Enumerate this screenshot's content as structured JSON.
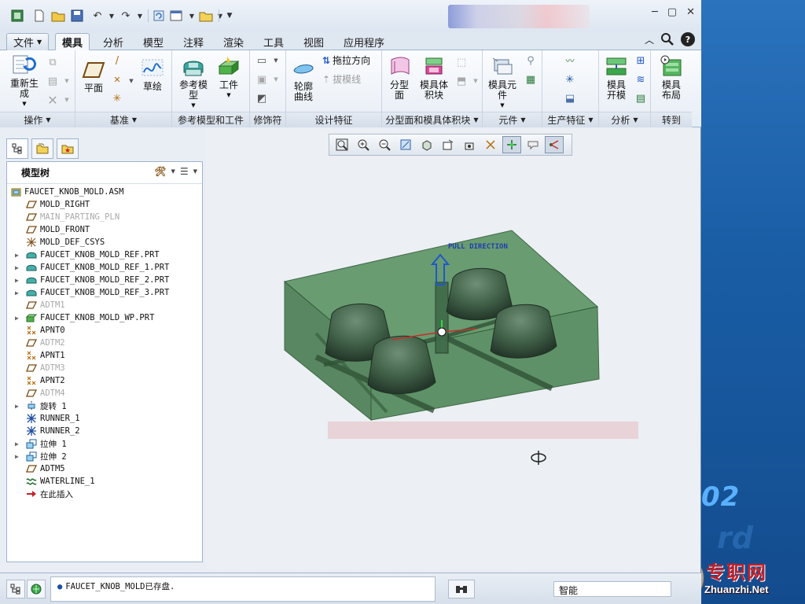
{
  "quick_access": {
    "icons": [
      "app-icon",
      "new-icon",
      "open-icon",
      "save-icon",
      "undo-icon",
      "redo-icon",
      "regenerate-icon",
      "window-icon",
      "folder-icon",
      "customize-icon"
    ]
  },
  "tabs": [
    {
      "label": "文件"
    },
    {
      "label": "模具"
    },
    {
      "label": "分析"
    },
    {
      "label": "模型"
    },
    {
      "label": "注释"
    },
    {
      "label": "渲染"
    },
    {
      "label": "工具"
    },
    {
      "label": "视图"
    },
    {
      "label": "应用程序"
    }
  ],
  "ribbon": {
    "regenerate": "重新生\n成",
    "plane": "平面",
    "sketch": "草绘",
    "ref_model": "参考模\n型",
    "workpiece": "工件",
    "profile_curve": "轮廓\n曲线",
    "pull_direction": "拖拉方向",
    "draft_line": "拔模线",
    "parting_surface": "分型\n面",
    "mold_volume": "模具体\n积块",
    "mold_component": "模具元\n件",
    "mold_opening": "模具\n开模",
    "mold_layout": "模具\n布局",
    "groups": {
      "operations": "操作",
      "datum": "基准",
      "ref_model_workpiece": "参考模型和工件",
      "modifiers": "修饰符",
      "design_features": "设计特征",
      "parting_volume": "分型面和模具体积块",
      "components": "元件",
      "production_features": "生产特征",
      "analysis": "分析",
      "goto": "转到"
    }
  },
  "model_tree": {
    "title": "模型树",
    "items": [
      {
        "label": "FAUCET_KNOB_MOLD.ASM",
        "icon": "assembly-icon",
        "expand": false,
        "dim": false,
        "indent": 0
      },
      {
        "label": "MOLD_RIGHT",
        "icon": "datum-plane-icon",
        "expand": false,
        "dim": false,
        "indent": 1
      },
      {
        "label": "MAIN_PARTING_PLN",
        "icon": "datum-plane-icon",
        "expand": false,
        "dim": true,
        "indent": 1
      },
      {
        "label": "MOLD_FRONT",
        "icon": "datum-plane-icon",
        "expand": false,
        "dim": false,
        "indent": 1
      },
      {
        "label": "MOLD_DEF_CSYS",
        "icon": "csys-icon",
        "expand": false,
        "dim": false,
        "indent": 1
      },
      {
        "label": "FAUCET_KNOB_MOLD_REF.PRT",
        "icon": "part-icon",
        "expand": true,
        "dim": false,
        "indent": 1
      },
      {
        "label": "FAUCET_KNOB_MOLD_REF_1.PRT",
        "icon": "part-icon",
        "expand": true,
        "dim": false,
        "indent": 1
      },
      {
        "label": "FAUCET_KNOB_MOLD_REF_2.PRT",
        "icon": "part-icon",
        "expand": true,
        "dim": false,
        "indent": 1
      },
      {
        "label": "FAUCET_KNOB_MOLD_REF_3.PRT",
        "icon": "part-icon",
        "expand": true,
        "dim": false,
        "indent": 1
      },
      {
        "label": "ADTM1",
        "icon": "datum-plane-icon",
        "expand": false,
        "dim": true,
        "indent": 1
      },
      {
        "label": "FAUCET_KNOB_MOLD_WP.PRT",
        "icon": "workpiece-icon",
        "expand": true,
        "dim": false,
        "indent": 1
      },
      {
        "label": "APNT0",
        "icon": "datum-point-icon",
        "expand": false,
        "dim": false,
        "indent": 1
      },
      {
        "label": "ADTM2",
        "icon": "datum-plane-icon",
        "expand": false,
        "dim": true,
        "indent": 1
      },
      {
        "label": "APNT1",
        "icon": "datum-point-icon",
        "expand": false,
        "dim": false,
        "indent": 1
      },
      {
        "label": "ADTM3",
        "icon": "datum-plane-icon",
        "expand": false,
        "dim": true,
        "indent": 1
      },
      {
        "label": "APNT2",
        "icon": "datum-point-icon",
        "expand": false,
        "dim": false,
        "indent": 1
      },
      {
        "label": "ADTM4",
        "icon": "datum-plane-icon",
        "expand": false,
        "dim": true,
        "indent": 1
      },
      {
        "label": "旋转 1",
        "icon": "revolve-icon",
        "expand": true,
        "dim": false,
        "indent": 1
      },
      {
        "label": "RUNNER_1",
        "icon": "runner-icon",
        "expand": false,
        "dim": false,
        "indent": 1
      },
      {
        "label": "RUNNER_2",
        "icon": "runner-icon",
        "expand": false,
        "dim": false,
        "indent": 1
      },
      {
        "label": "拉伸 1",
        "icon": "extrude-icon",
        "expand": true,
        "dim": false,
        "indent": 1
      },
      {
        "label": "拉伸 2",
        "icon": "extrude-icon",
        "expand": true,
        "dim": false,
        "indent": 1
      },
      {
        "label": "ADTM5",
        "icon": "datum-plane-icon",
        "expand": false,
        "dim": false,
        "indent": 1
      },
      {
        "label": "WATERLINE_1",
        "icon": "waterline-icon",
        "expand": false,
        "dim": false,
        "indent": 1
      },
      {
        "label": "在此插入",
        "icon": "insert-arrow-icon",
        "expand": false,
        "dim": false,
        "indent": 1
      }
    ]
  },
  "graphics": {
    "pull_direction_label": "PULL DIRECTION",
    "colors": {
      "mold_body": "#4f8a5a",
      "mold_edge": "#2f5d38",
      "cavity": "#3d5b44",
      "arrow": "#1f57c9"
    }
  },
  "status": {
    "message": "FAUCET_KNOB_MOLD已存盘.",
    "filter_value": "智能"
  },
  "desktop": {
    "big_text": "02",
    "ghost_text": "rd",
    "watermark_cn": "专职网",
    "watermark_url": "Zhuanzhi.Net"
  }
}
